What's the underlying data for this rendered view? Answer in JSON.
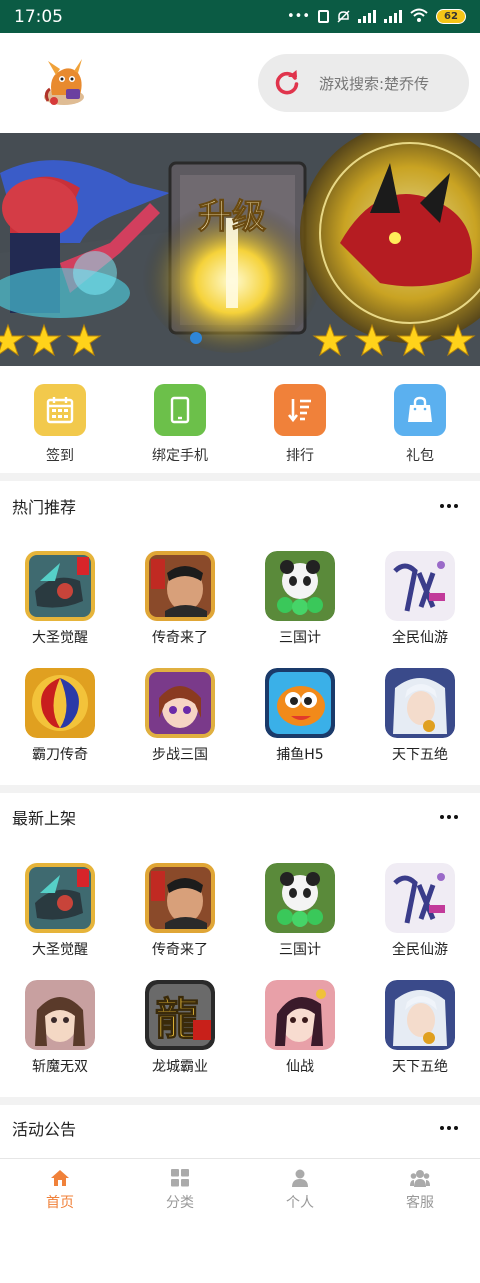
{
  "status_bar": {
    "time": "17:05",
    "dots": "•••",
    "battery": "62"
  },
  "header": {
    "search_placeholder": "游戏搜索:楚乔传"
  },
  "banner": {
    "title_text": "升级"
  },
  "quick_menu": [
    {
      "label": "签到",
      "icon": "calendar-icon",
      "color": "#f2c94c"
    },
    {
      "label": "绑定手机",
      "icon": "phone-icon",
      "color": "#6cc04a"
    },
    {
      "label": "排行",
      "icon": "ranking-icon",
      "color": "#f0813a"
    },
    {
      "label": "礼包",
      "icon": "gift-bag-icon",
      "color": "#5bb0ef"
    }
  ],
  "hot": {
    "title": "热门推荐",
    "games": [
      {
        "name": "大圣觉醒"
      },
      {
        "name": "传奇来了"
      },
      {
        "name": "三国计"
      },
      {
        "name": "全民仙游"
      },
      {
        "name": "霸刀传奇"
      },
      {
        "name": "步战三国"
      },
      {
        "name": "捕鱼H5"
      },
      {
        "name": "天下五绝"
      }
    ]
  },
  "newest": {
    "title": "最新上架",
    "games": [
      {
        "name": "大圣觉醒"
      },
      {
        "name": "传奇来了"
      },
      {
        "name": "三国计"
      },
      {
        "name": "全民仙游"
      },
      {
        "name": "斩魔无双"
      },
      {
        "name": "龙城霸业"
      },
      {
        "name": "仙战"
      },
      {
        "name": "天下五绝"
      }
    ]
  },
  "activity": {
    "title": "活动公告"
  },
  "bottom_nav": [
    {
      "label": "首页",
      "icon": "home-icon",
      "active": true
    },
    {
      "label": "分类",
      "icon": "grid-icon",
      "active": false
    },
    {
      "label": "个人",
      "icon": "person-icon",
      "active": false
    },
    {
      "label": "客服",
      "icon": "group-icon",
      "active": false
    }
  ],
  "colors": {
    "status_bar": "#0b5b44",
    "accent": "#f0813a",
    "search_refresh": "#e0344c"
  }
}
